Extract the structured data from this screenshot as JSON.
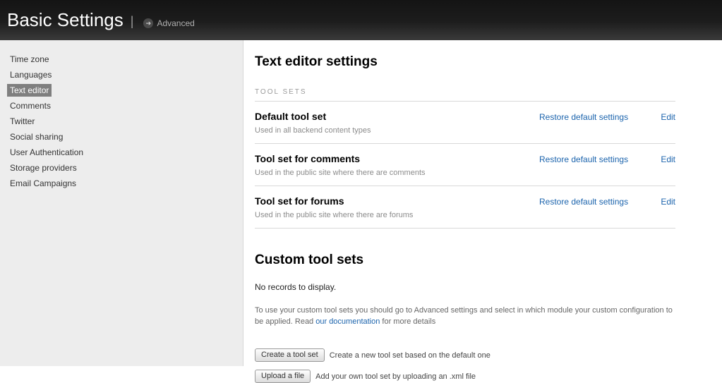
{
  "header": {
    "title": "Basic Settings",
    "separator": "|",
    "advanced_label": "Advanced"
  },
  "sidebar": {
    "items": [
      {
        "label": "Time zone",
        "selected": false
      },
      {
        "label": "Languages",
        "selected": false
      },
      {
        "label": "Text editor",
        "selected": true
      },
      {
        "label": "Comments",
        "selected": false
      },
      {
        "label": "Twitter",
        "selected": false
      },
      {
        "label": "Social sharing",
        "selected": false
      },
      {
        "label": "User Authentication",
        "selected": false
      },
      {
        "label": "Storage providers",
        "selected": false
      },
      {
        "label": "Email Campaigns",
        "selected": false
      }
    ]
  },
  "main": {
    "title": "Text editor settings",
    "toolsets_heading": "TOOL SETS",
    "toolsets": [
      {
        "name": "Default tool set",
        "description": "Used in all backend content types",
        "restore_label": "Restore default settings",
        "edit_label": "Edit"
      },
      {
        "name": "Tool set for comments",
        "description": "Used in the public site where there are comments",
        "restore_label": "Restore default settings",
        "edit_label": "Edit"
      },
      {
        "name": "Tool set for forums",
        "description": "Used in the public site where there are forums",
        "restore_label": "Restore default settings",
        "edit_label": "Edit"
      }
    ],
    "custom": {
      "title": "Custom tool sets",
      "no_records": "No records to display.",
      "info_pre": "To use your custom tool sets you should go to Advanced settings and select in which module your custom configuration to be applied. Read ",
      "info_link": "our documentation",
      "info_post": " for more details",
      "create_button": "Create a tool set",
      "create_hint": "Create a new tool set based on the default one",
      "upload_button": "Upload a file",
      "upload_hint": "Add your own tool set by uploading an .xml file"
    }
  },
  "colors": {
    "link_blue": "#1c64ad",
    "selected_item_bg": "#7f7f7f",
    "header_bg": "#1d1d1d"
  }
}
